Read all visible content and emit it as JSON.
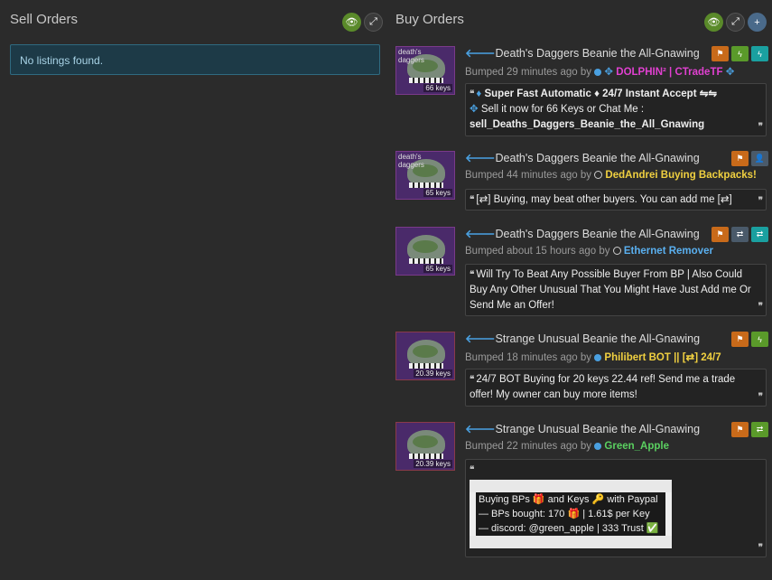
{
  "sell": {
    "title": "Sell Orders",
    "no_listings": "No listings found."
  },
  "buy": {
    "title": "Buy Orders",
    "listings": [
      {
        "thumb_label": "death's daggers",
        "price": "66 keys",
        "title": "Death's Daggers Beanie the All-Gnawing",
        "bump_text": "Bumped 29 minutes ago by",
        "user": "DOLPHIN² | CTradeTF",
        "user_color": "#e040d0",
        "quote_lines": [
          "Super Fast Automatic ♦ 24/7 Instant Accept ⇋⇋",
          "Sell it now for 66 Keys or Chat Me :",
          "sell_Deaths_Daggers_Beanie_the_All_Gnawing"
        ]
      },
      {
        "thumb_label": "death's daggers",
        "price": "65 keys",
        "title": "Death's Daggers Beanie the All-Gnawing",
        "bump_text": "Bumped 44 minutes ago by",
        "user": "DedAndrei Buying Backpacks!",
        "user_color": "#f0d040",
        "quote_lines": [
          "[⇄] Buying, may beat other buyers. You can add me [⇄]"
        ]
      },
      {
        "thumb_label": "",
        "price": "65 keys",
        "title": "Death's Daggers Beanie the All-Gnawing",
        "bump_text": "Bumped about 15 hours ago by",
        "user": "Ethernet Remover",
        "user_color": "#5ab0f0",
        "quote_lines": [
          "Will Try To Beat Any Possible Buyer From BP | Also Could Buy Any Other Unusual That You Might Have Just Add me Or Send Me an Offer!"
        ]
      },
      {
        "thumb_label": "",
        "price": "20.39 keys",
        "title": "Strange Unusual Beanie the All-Gnawing",
        "bump_text": "Bumped 18 minutes ago by",
        "user": "Philibert BOT || [⇄] 24/7",
        "user_color": "#f0d040",
        "quote_lines": [
          "24/7 BOT Buying for 20 keys 22.44 ref! Send me a trade offer! My owner can buy more items!"
        ]
      },
      {
        "thumb_label": "",
        "price": "20.39 keys",
        "title": "Strange Unusual Beanie the All-Gnawing",
        "bump_text": "Bumped 22 minutes ago by",
        "user": "Green_Apple",
        "user_color": "#5ad060",
        "quote_lines": [
          "Buying BPs 🎁 and Keys 🔑 with Paypal",
          "— BPs bought: 170 🎁 | 1.61$ per Key",
          "— discord: @green_apple | 333 Trust ✅"
        ]
      }
    ]
  }
}
